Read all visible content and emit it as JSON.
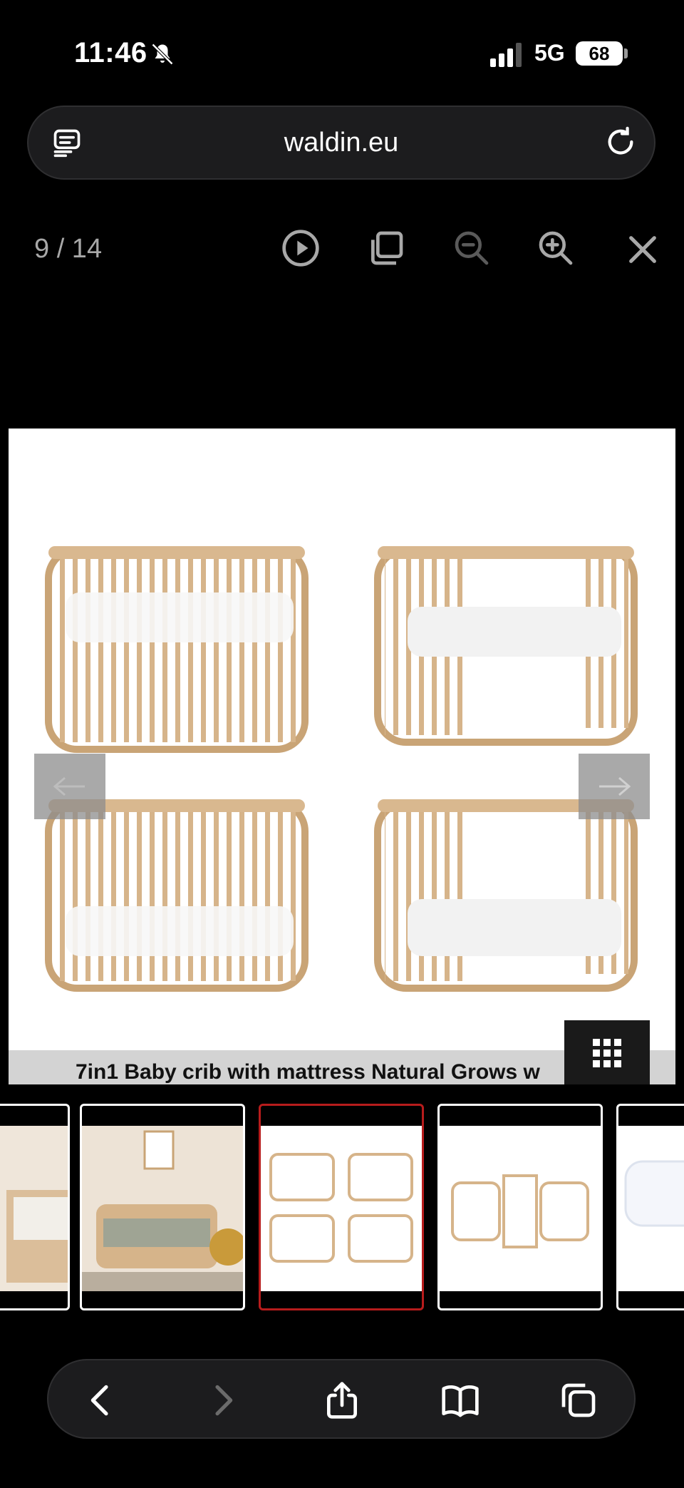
{
  "status_bar": {
    "time": "11:46",
    "network": "5G",
    "battery": "68"
  },
  "address_bar": {
    "url": "waldin.eu"
  },
  "viewer": {
    "counter": "9 / 14",
    "caption": "7in1 Baby crib with mattress Natural Grows w"
  },
  "thumbnails": [
    {
      "name": "thumb-crib-in-room",
      "active": false
    },
    {
      "name": "thumb-nursery-sofa",
      "active": false
    },
    {
      "name": "thumb-four-cribs",
      "active": true
    },
    {
      "name": "thumb-chairs-table",
      "active": false
    },
    {
      "name": "thumb-mattress",
      "active": false
    }
  ],
  "icons": {
    "reader": "reader-icon",
    "reload": "reload-icon",
    "play": "play-icon",
    "copy": "copy-icon",
    "zoom_out": "zoom-out-icon",
    "zoom_in": "zoom-in-icon",
    "close": "close-icon",
    "back": "chevron-left-icon",
    "forward": "chevron-right-icon",
    "share": "share-icon",
    "bookmarks": "book-icon",
    "tabs": "tabs-icon"
  },
  "colors": {
    "background": "#000000",
    "active_thumb_border": "#b71c1c",
    "wood": "#d6b48a"
  }
}
